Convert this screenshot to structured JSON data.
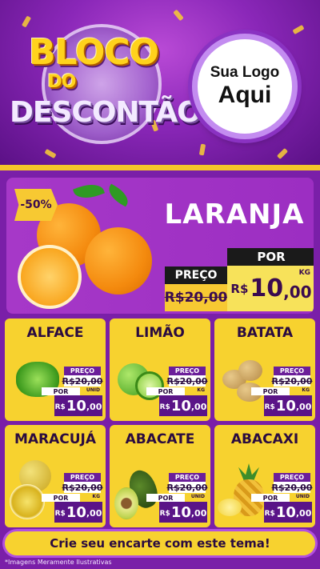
{
  "header": {
    "title_line1": "BLOCO",
    "title_line2": "DO",
    "title_line3": "DESCONTÃO",
    "logo_line1": "Sua Logo",
    "logo_line2": "Aqui"
  },
  "featured": {
    "discount": "-50%",
    "name": "LARANJA",
    "por_label": "POR",
    "preco_label": "PREÇO",
    "old_price": "R$20,00",
    "currency": "R$",
    "new_price_int": "10",
    "new_price_dec": ",00",
    "unit": "KG"
  },
  "cards": [
    {
      "name": "ALFACE",
      "preco_label": "PREÇO",
      "old_price": "R$20,00",
      "por_label": "POR",
      "currency": "R$",
      "price_int": "10",
      "price_dec": ",00",
      "unit": "UNID"
    },
    {
      "name": "LIMÃO",
      "preco_label": "PREÇO",
      "old_price": "R$20,00",
      "por_label": "POR",
      "currency": "R$",
      "price_int": "10",
      "price_dec": ",00",
      "unit": "KG"
    },
    {
      "name": "BATATA",
      "preco_label": "PREÇO",
      "old_price": "R$20,00",
      "por_label": "POR",
      "currency": "R$",
      "price_int": "10",
      "price_dec": ",00",
      "unit": "KG"
    },
    {
      "name": "MARACUJÁ",
      "preco_label": "PREÇO",
      "old_price": "R$20,00",
      "por_label": "POR",
      "currency": "R$",
      "price_int": "10",
      "price_dec": ",00",
      "unit": "KG"
    },
    {
      "name": "ABACATE",
      "preco_label": "PREÇO",
      "old_price": "R$20,00",
      "por_label": "POR",
      "currency": "R$",
      "price_int": "10",
      "price_dec": ",00",
      "unit": "UNID"
    },
    {
      "name": "ABACAXI",
      "preco_label": "PREÇO",
      "old_price": "R$20,00",
      "por_label": "POR",
      "currency": "R$",
      "price_int": "10",
      "price_dec": ",00",
      "unit": "UNID"
    }
  ],
  "cta": "Crie seu encarte com este tema!",
  "footnote": "*Imagens Meramente Ilustrativas",
  "colors": {
    "background": "#7a1fa8",
    "accent_yellow": "#f7d22f",
    "price_purple": "#5a1488"
  }
}
